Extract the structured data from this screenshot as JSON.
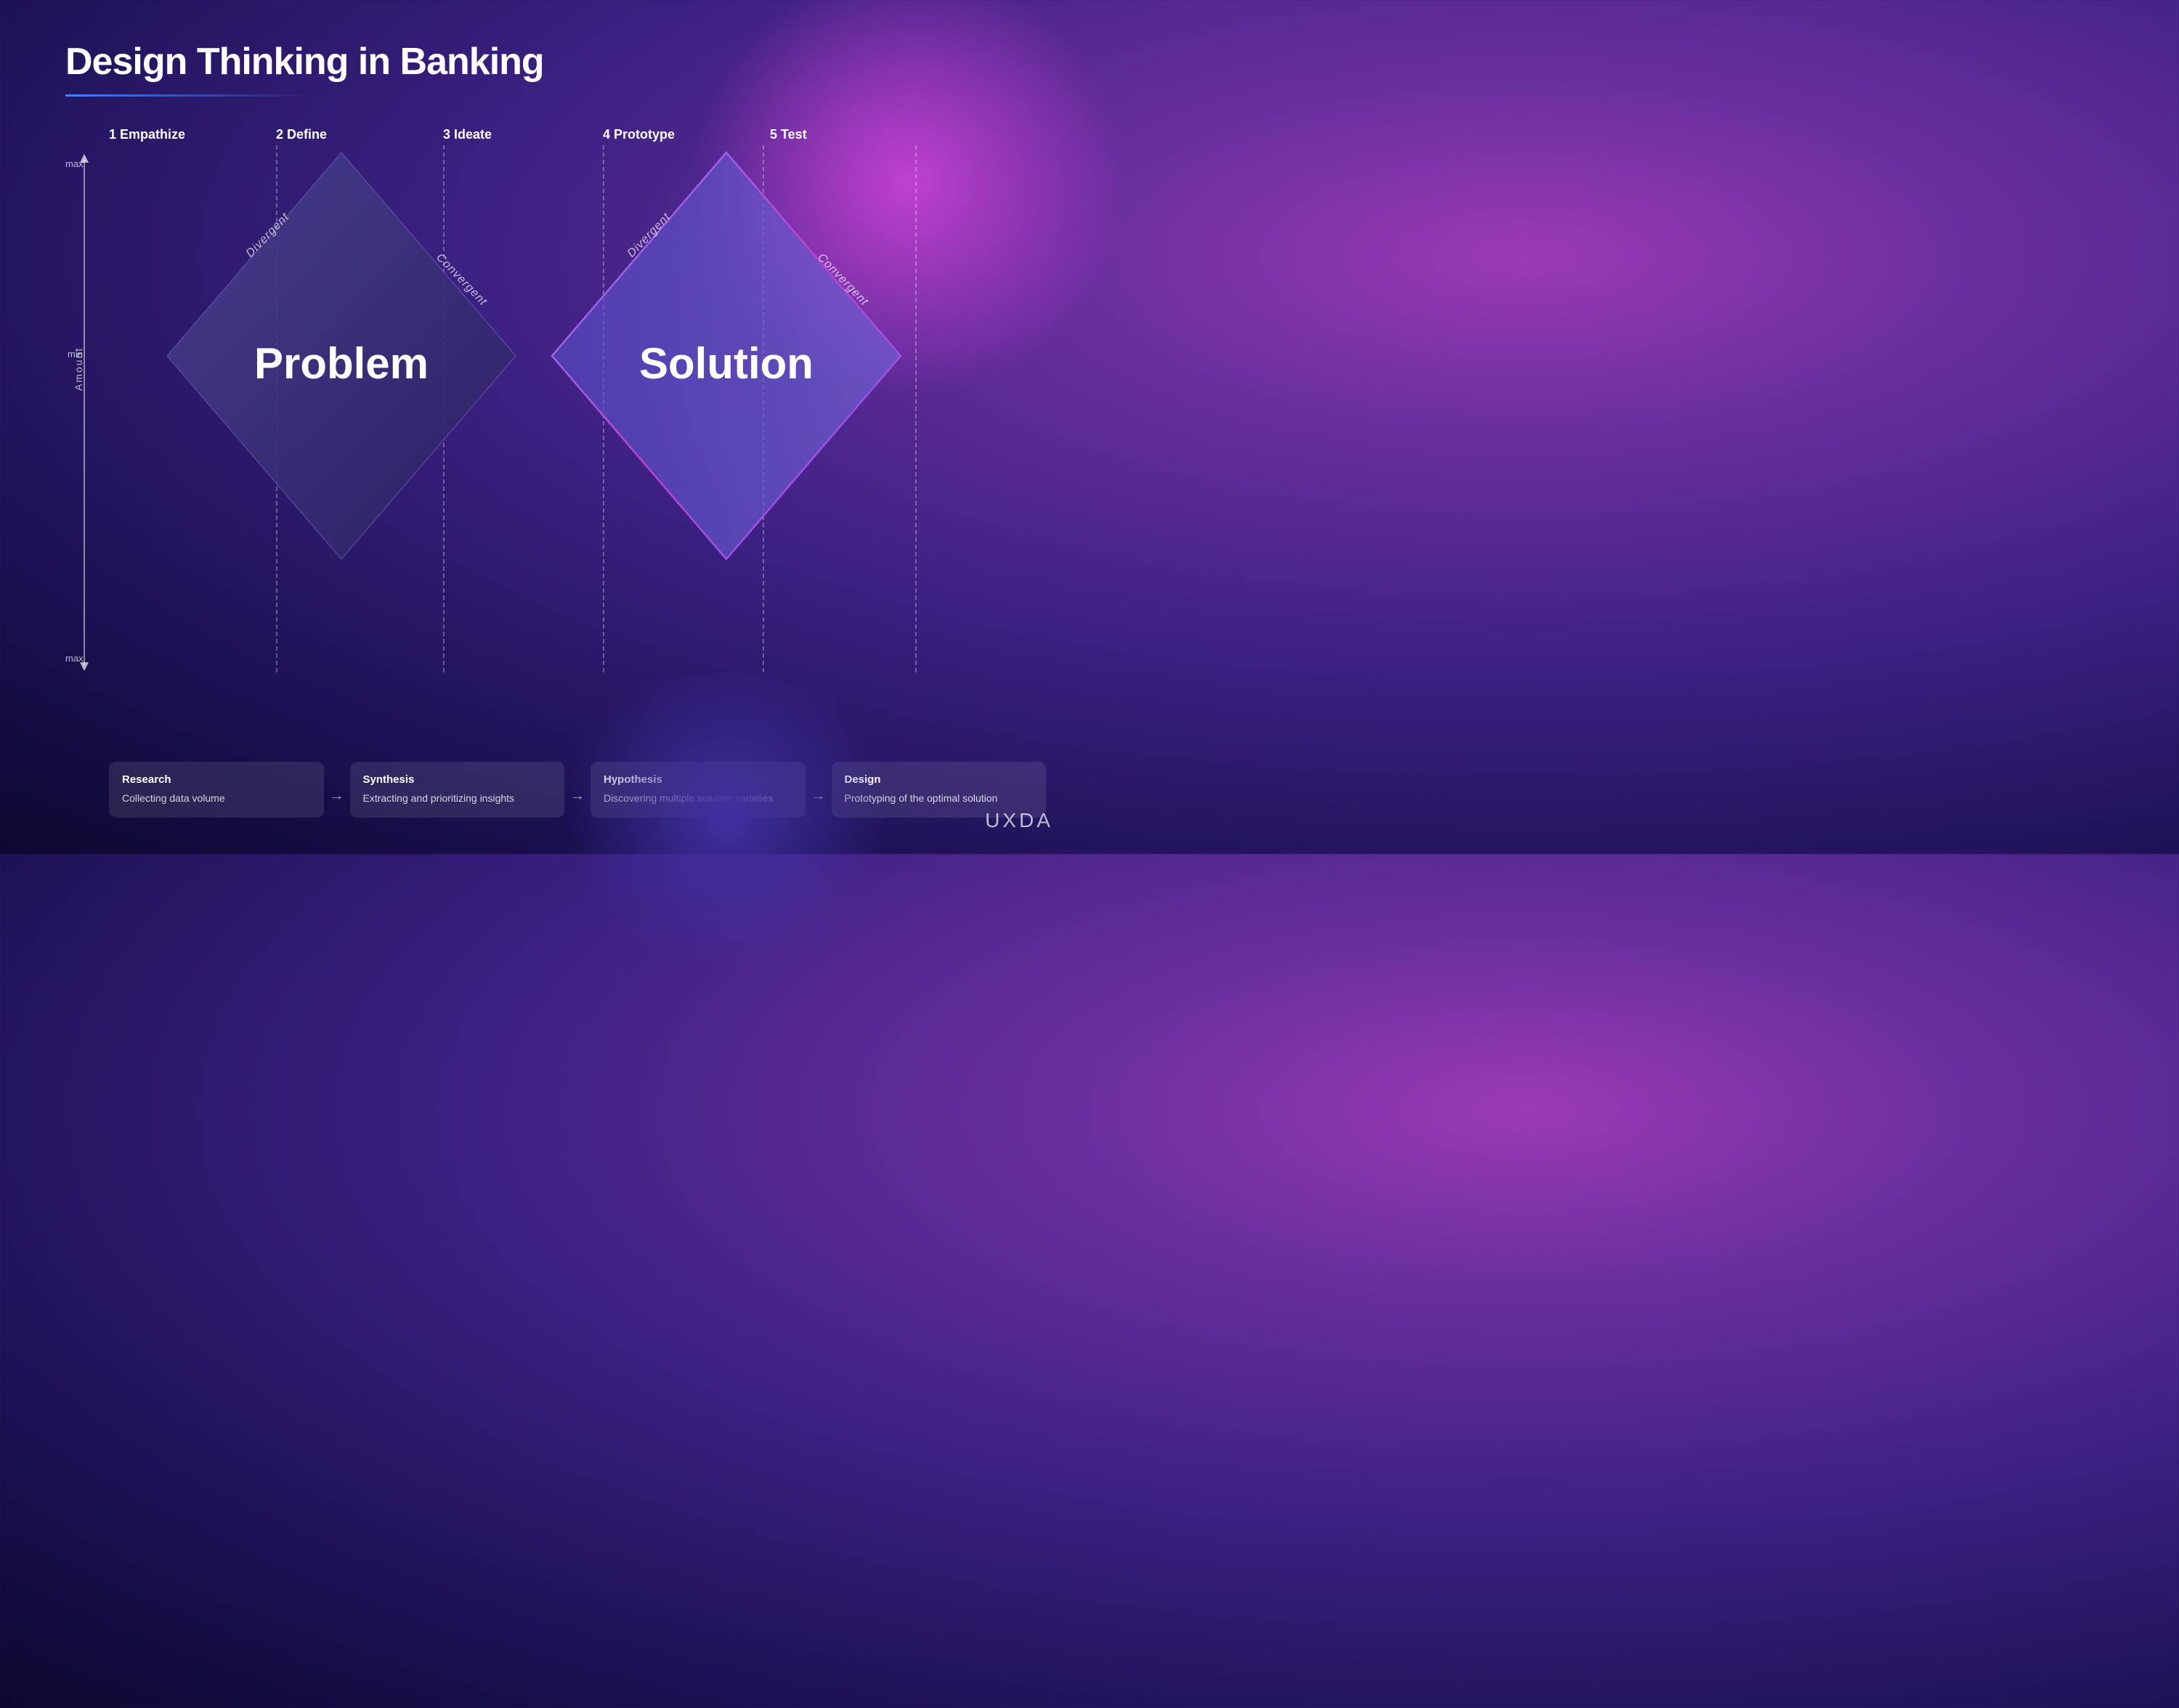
{
  "title": "Design Thinking in Banking",
  "steps": [
    {
      "id": "step1",
      "number": "1",
      "label": "Empathize"
    },
    {
      "id": "step2",
      "number": "2",
      "label": "Define"
    },
    {
      "id": "step3",
      "number": "3",
      "label": "Ideate"
    },
    {
      "id": "step4",
      "number": "4",
      "label": "Prototype"
    },
    {
      "id": "step5",
      "number": "5",
      "label": "Test"
    }
  ],
  "diamondLabels": {
    "problem": "Problem",
    "solution": "Solution"
  },
  "axisLabels": {
    "amount": "Amount",
    "maxTop": "max",
    "min": "min",
    "maxBottom": "max"
  },
  "divergentLabel": "Divergent",
  "convergentLabel": "Convergent",
  "cards": [
    {
      "id": "research",
      "title": "Research",
      "description": "Collecting data volume"
    },
    {
      "id": "synthesis",
      "title": "Synthesis",
      "description": "Extracting and prioritizing insights"
    },
    {
      "id": "hypothesis",
      "title": "Hypothesis",
      "description": "Discovering multiple solution varieties"
    },
    {
      "id": "design",
      "title": "Design",
      "description": "Prototyping of the optimal solution"
    }
  ],
  "logo": "UXDA",
  "colors": {
    "background_start": "#9b3ab5",
    "background_end": "#0d0830",
    "problem_diamond": "#3a3080",
    "solution_diamond_left": "#5545c0",
    "solution_diamond_right": "#c040a0",
    "card_bg": "rgba(255,255,255,0.1)"
  }
}
